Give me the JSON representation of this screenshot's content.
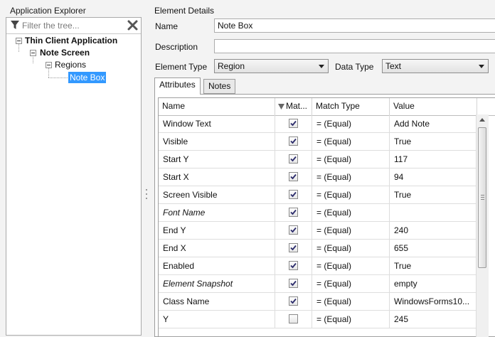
{
  "explorer": {
    "title": "Application Explorer",
    "filter_placeholder": "Filter the tree...",
    "tree": {
      "root": "Thin Client Application",
      "screen": "Note Screen",
      "group": "Regions",
      "leaf": "Note Box"
    }
  },
  "details": {
    "title": "Element Details",
    "name_label": "Name",
    "name_value": "Note Box",
    "description_label": "Description",
    "description_value": "",
    "element_type_label": "Element Type",
    "element_type_value": "Region",
    "data_type_label": "Data Type",
    "data_type_value": "Text"
  },
  "tabs": [
    "Attributes",
    "Notes"
  ],
  "grid": {
    "columns": [
      "Name",
      "Mat...",
      "Match Type",
      "Value"
    ],
    "rows": [
      {
        "name": "Window Text",
        "italic": false,
        "checked": true,
        "match_type": "= (Equal)",
        "value": "Add Note"
      },
      {
        "name": "Visible",
        "italic": false,
        "checked": true,
        "match_type": "= (Equal)",
        "value": "True"
      },
      {
        "name": "Start Y",
        "italic": false,
        "checked": true,
        "match_type": "= (Equal)",
        "value": "117"
      },
      {
        "name": "Start X",
        "italic": false,
        "checked": true,
        "match_type": "= (Equal)",
        "value": "94"
      },
      {
        "name": "Screen Visible",
        "italic": false,
        "checked": true,
        "match_type": "= (Equal)",
        "value": "True"
      },
      {
        "name": "Font Name",
        "italic": true,
        "checked": true,
        "match_type": "= (Equal)",
        "value": ""
      },
      {
        "name": "End Y",
        "italic": false,
        "checked": true,
        "match_type": "= (Equal)",
        "value": "240"
      },
      {
        "name": "End X",
        "italic": false,
        "checked": true,
        "match_type": "= (Equal)",
        "value": "655"
      },
      {
        "name": "Enabled",
        "italic": false,
        "checked": true,
        "match_type": "= (Equal)",
        "value": "True"
      },
      {
        "name": "Element Snapshot",
        "italic": true,
        "checked": true,
        "match_type": "= (Equal)",
        "value": "empty"
      },
      {
        "name": "Class Name",
        "italic": false,
        "checked": true,
        "match_type": "= (Equal)",
        "value": "WindowsForms10..."
      },
      {
        "name": "Y",
        "italic": false,
        "checked": false,
        "match_type": "= (Equal)",
        "value": "245"
      }
    ]
  },
  "icons": {
    "filter": "filter-funnel-icon",
    "clear": "clear-x-icon",
    "sort": "sort-triangle-icon",
    "check": "checkmark-icon"
  },
  "colors": {
    "selection": "#3399ff",
    "panel_background": "#f3f3f3"
  }
}
